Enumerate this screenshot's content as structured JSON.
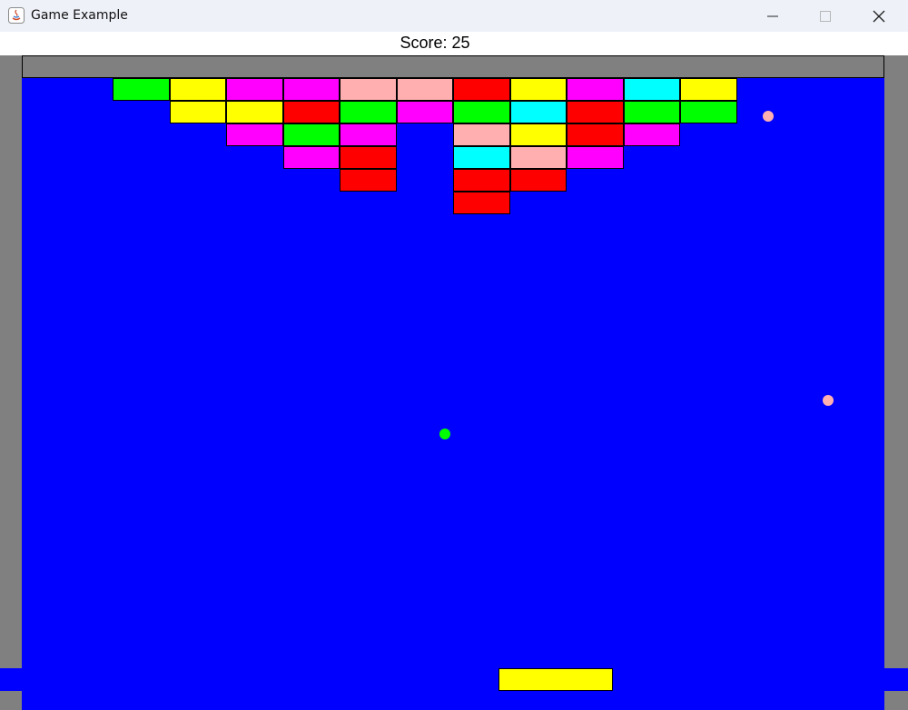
{
  "window": {
    "title": "Game Example",
    "controls": [
      "minimize-icon",
      "maximize-icon",
      "close-icon"
    ]
  },
  "hud": {
    "score_text": "Score: 25"
  },
  "colors": {
    "background": "#0000ff",
    "frame": "#808080",
    "paddle": "#ffff00",
    "G": "#00ff00",
    "Y": "#ffff00",
    "M": "#ff00ff",
    "P": "#ffafaf",
    "R": "#ff0000",
    "C": "#00ffff"
  },
  "bricks": [
    [
      null,
      null,
      "G",
      "Y",
      "M",
      "M",
      "P",
      "P",
      "R",
      "Y",
      "M",
      "C",
      "Y",
      null,
      null
    ],
    [
      null,
      null,
      null,
      "Y",
      "Y",
      "R",
      "G",
      "M",
      "G",
      "C",
      "R",
      "G",
      "G",
      null,
      null
    ],
    [
      null,
      null,
      null,
      null,
      "M",
      "G",
      "M",
      null,
      "P",
      "Y",
      "R",
      "M",
      null,
      null,
      null
    ],
    [
      null,
      null,
      null,
      null,
      null,
      "M",
      "R",
      null,
      "C",
      "P",
      "M",
      null,
      null,
      null,
      null
    ],
    [
      null,
      null,
      null,
      null,
      null,
      null,
      "R",
      null,
      "R",
      "R",
      null,
      null,
      null,
      null,
      null
    ],
    [
      null,
      null,
      null,
      null,
      null,
      null,
      null,
      null,
      "R",
      null,
      null,
      null,
      null,
      null,
      null
    ]
  ],
  "balls": [
    {
      "name": "ball-green",
      "color": "#00ff00"
    },
    {
      "name": "ball-pink-1",
      "color": "#ffafaf"
    },
    {
      "name": "ball-pink-2",
      "color": "#ffafaf"
    }
  ]
}
